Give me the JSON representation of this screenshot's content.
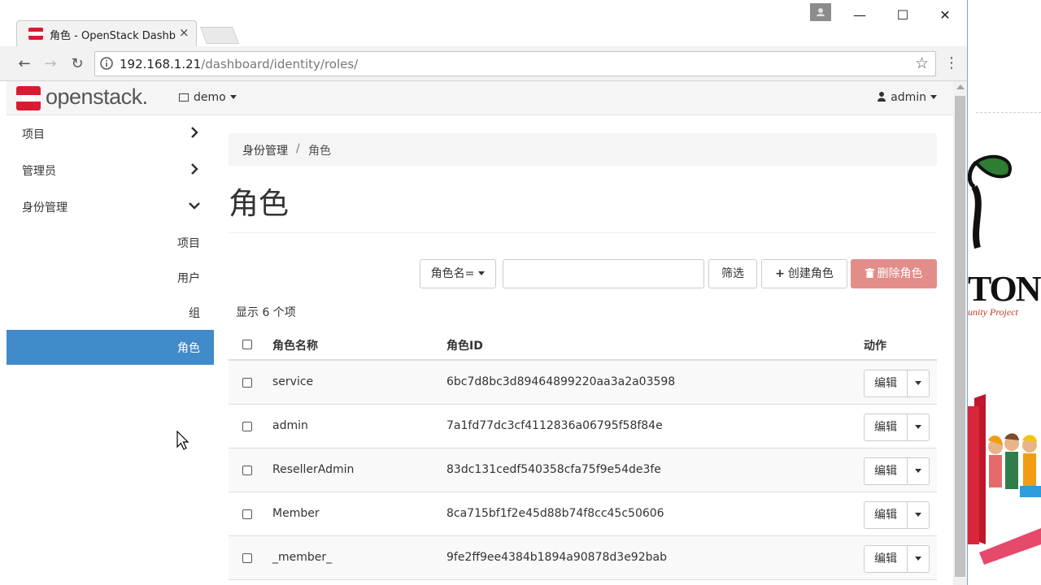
{
  "browser": {
    "tab_title": "角色 - OpenStack Dashb",
    "tab_close": "×",
    "url_host": "192.168.1.21",
    "url_path": "/dashboard/identity/roles/",
    "window_minimize": "—",
    "window_maximize": "☐",
    "window_close": "✕",
    "back_glyph": "←",
    "forward_glyph": "→",
    "reload_glyph": "↻",
    "star_glyph": "☆",
    "menu_glyph": "⋮"
  },
  "topnav": {
    "logo_text": "openstack.",
    "project": "demo",
    "user": "admin"
  },
  "sidebar": {
    "items": [
      {
        "label": "项目"
      },
      {
        "label": "管理员"
      },
      {
        "label": "身份管理"
      }
    ],
    "sub_items": [
      {
        "label": "项目"
      },
      {
        "label": "用户"
      },
      {
        "label": "组"
      },
      {
        "label": "角色"
      }
    ]
  },
  "main": {
    "breadcrumb": [
      "身份管理",
      "/",
      "角色"
    ],
    "title": "角色",
    "filter_field": "角色名=",
    "filter_value": "",
    "filter_button": "筛选",
    "create_button": "创建角色",
    "delete_button": "删除角色",
    "count_text": "显示 6 个项"
  },
  "table": {
    "headers": [
      "角色名称",
      "角色ID",
      "动作"
    ],
    "rows": [
      {
        "name": "service",
        "id": "6bc7d8bc3d89464899220aa3a2a03598",
        "action": "编辑"
      },
      {
        "name": "admin",
        "id": "7a1fd77dc3cf4112836a06795f58f84e",
        "action": "编辑"
      },
      {
        "name": "ResellerAdmin",
        "id": "83dc131cedf540358cfa75f9e54de3fe",
        "action": "编辑"
      },
      {
        "name": "Member",
        "id": "8ca715bf1f2e45d88b74f8cc45c50606",
        "action": "编辑"
      },
      {
        "name": "_member_",
        "id": "9fe2ff9ee4384b1894a90878d3e92bab",
        "action": "编辑"
      }
    ]
  },
  "desktop": {
    "logo_text": "TONI",
    "tagline": "unity Project"
  },
  "colors": {
    "accent": "#428bca",
    "danger_disabled": "#e38d8b",
    "brand_red": "#da1a32"
  }
}
